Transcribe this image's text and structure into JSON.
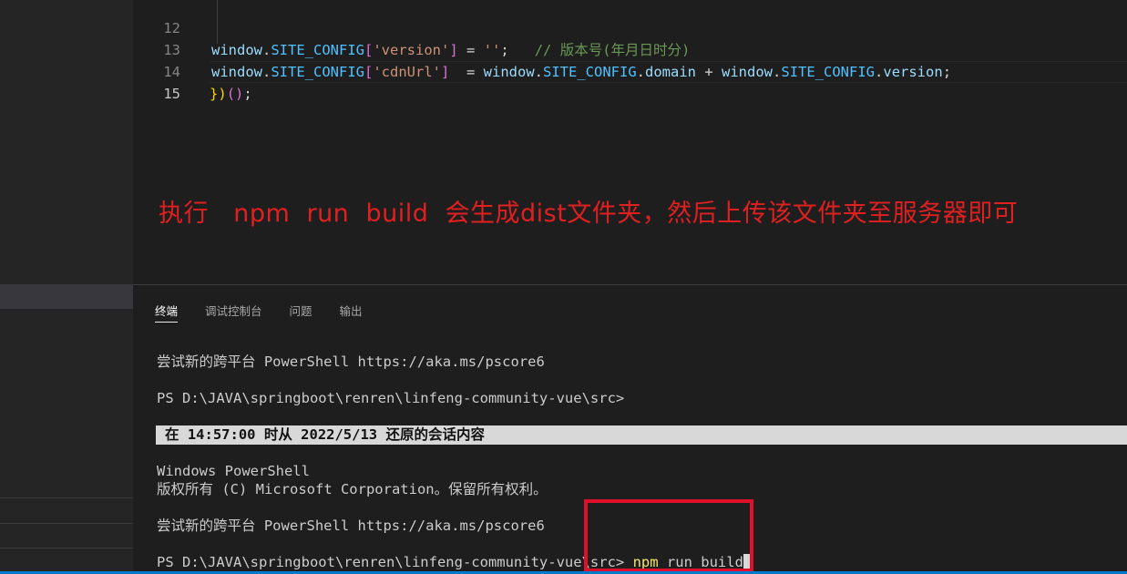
{
  "editor": {
    "lines": [
      {
        "number": "12",
        "tokens": [
          "window",
          ".",
          "SITE_CONFIG",
          "[",
          "'version'",
          "]",
          " = ",
          "''",
          ";",
          "   ",
          "// 版本号(年月日时分)"
        ]
      },
      {
        "number": "13",
        "tokens": [
          "window",
          ".",
          "SITE_CONFIG",
          "[",
          "'cdnUrl'",
          "]",
          "  = ",
          "window",
          ".",
          "SITE_CONFIG",
          ".",
          "domain",
          " + ",
          "window",
          ".",
          "SITE_CONFIG",
          ".",
          "version",
          ";"
        ]
      },
      {
        "number": "14",
        "tokens": [
          "}",
          ")",
          "(",
          ")",
          ";"
        ]
      },
      {
        "number": "15",
        "tokens": []
      }
    ]
  },
  "annotation": {
    "text": "执行   npm  run  build  会生成dist文件夹，然后上传该文件夹至服务器即可"
  },
  "panel": {
    "tabs": [
      {
        "label": "终端",
        "active": true
      },
      {
        "label": "调试控制台",
        "active": false
      },
      {
        "label": "问题",
        "active": false
      },
      {
        "label": "输出",
        "active": false
      }
    ]
  },
  "terminal": {
    "line1": "尝试新的跨平台 PowerShell https://aka.ms/pscore6",
    "prompt1": "PS D:\\JAVA\\springboot\\renren\\linfeng-community-vue\\src>",
    "restore_banner": "在 14:57:00 时从 2022/5/13 还原的会话内容",
    "line_ps": "Windows PowerShell",
    "line_copyright": "版权所有 (C) Microsoft Corporation。保留所有权利。",
    "line2": "尝试新的跨平台 PowerShell https://aka.ms/pscore6",
    "prompt2": "PS D:\\JAVA\\springboot\\renren\\linfeng-community-vue\\src>",
    "command": "npm",
    "command_args": " run build"
  },
  "colors": {
    "highlight_box": "#e0102a",
    "annotation": "#e02020",
    "command": "#f5e66a"
  }
}
